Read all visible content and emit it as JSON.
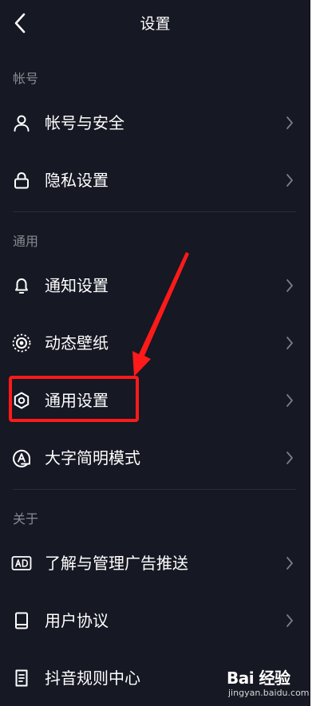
{
  "header": {
    "title": "设置",
    "back_icon": "chevron-left-icon"
  },
  "sections": [
    {
      "title": "帐号",
      "items": [
        {
          "label": "帐号与安全",
          "icon": "user-icon"
        },
        {
          "label": "隐私设置",
          "icon": "lock-icon"
        }
      ]
    },
    {
      "title": "通用",
      "items": [
        {
          "label": "通知设置",
          "icon": "bell-icon"
        },
        {
          "label": "动态壁纸",
          "icon": "live-wallpaper-icon"
        },
        {
          "label": "通用设置",
          "icon": "gear-icon"
        },
        {
          "label": "大字简明模式",
          "icon": "large-font-icon"
        }
      ]
    },
    {
      "title": "关于",
      "items": [
        {
          "label": "了解与管理广告推送",
          "icon": "ad-icon"
        },
        {
          "label": "用户协议",
          "icon": "book-icon"
        },
        {
          "label": "抖音规则中心",
          "icon": "document-icon"
        }
      ]
    }
  ],
  "annotation": {
    "color": "#ff1a1a",
    "highlighted_item": "通用设置"
  },
  "watermark": {
    "main": "Bai 经验",
    "sub": "jingyan.baidu.com"
  },
  "colors": {
    "background": "#161823",
    "text": "#ffffff",
    "section_text": "#8a8b91",
    "divider": "#2a2c36",
    "chevron": "#7c7d84"
  }
}
